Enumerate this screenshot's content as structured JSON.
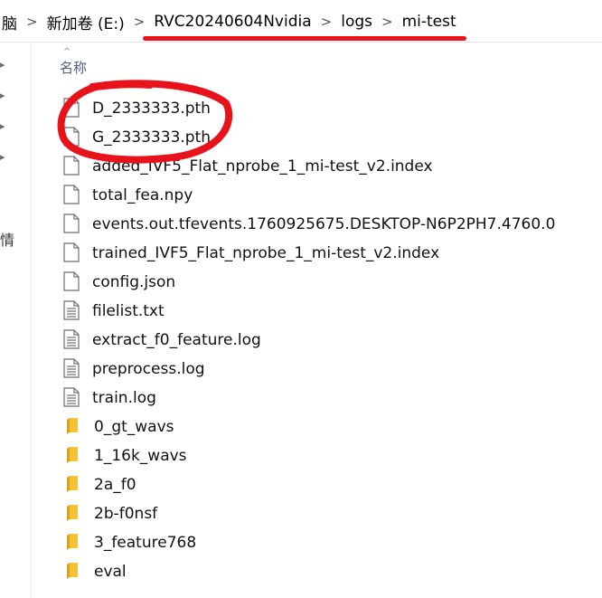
{
  "breadcrumb": {
    "items": [
      "脑",
      "新加卷 (E:)",
      "RVC20240604Nvidia",
      "logs",
      "mi-test"
    ]
  },
  "nav": {
    "fragment_char": "情"
  },
  "list": {
    "column_name": "名称",
    "files": [
      {
        "name": "D_2333333.pth",
        "kind": "file"
      },
      {
        "name": "G_2333333.pth",
        "kind": "file"
      },
      {
        "name": "added_IVF5_Flat_nprobe_1_mi-test_v2.index",
        "kind": "file"
      },
      {
        "name": "total_fea.npy",
        "kind": "file"
      },
      {
        "name": "events.out.tfevents.1760925675.DESKTOP-N6P2PH7.4760.0",
        "kind": "file"
      },
      {
        "name": "trained_IVF5_Flat_nprobe_1_mi-test_v2.index",
        "kind": "file"
      },
      {
        "name": "config.json",
        "kind": "file"
      },
      {
        "name": "filelist.txt",
        "kind": "text"
      },
      {
        "name": "extract_f0_feature.log",
        "kind": "text"
      },
      {
        "name": "preprocess.log",
        "kind": "text"
      },
      {
        "name": "train.log",
        "kind": "text"
      },
      {
        "name": "0_gt_wavs",
        "kind": "folder"
      },
      {
        "name": "1_16k_wavs",
        "kind": "folder"
      },
      {
        "name": "2a_f0",
        "kind": "folder"
      },
      {
        "name": "2b-f0nsf",
        "kind": "folder"
      },
      {
        "name": "3_feature768",
        "kind": "folder"
      },
      {
        "name": "eval",
        "kind": "folder"
      }
    ]
  },
  "colors": {
    "annotation_red": "#e8131a",
    "folder_yellow": "#f3c13a",
    "header_text": "#4d6082"
  },
  "icons": {
    "file": "blank-file-icon",
    "text": "text-file-icon",
    "folder": "folder-icon",
    "separator": "chevron-right-icon"
  }
}
